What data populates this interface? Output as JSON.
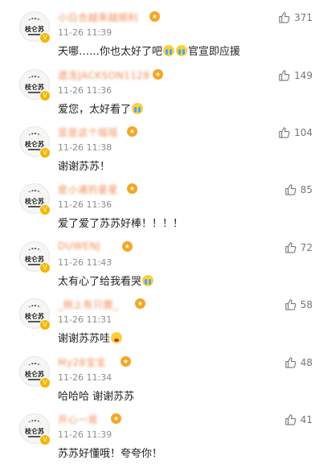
{
  "comments": [
    {
      "user": "小白合越来越顺利",
      "time": "11-26 11:39",
      "likes": "371",
      "parts": [
        {
          "t": "text",
          "v": "天哪……你也太好了吧"
        },
        {
          "t": "emoji",
          "v": "crying-face"
        },
        {
          "t": "emoji",
          "v": "crying-face"
        },
        {
          "t": "text",
          "v": "官宣即应援"
        }
      ]
    },
    {
      "user": "遗冻JACKSON1128",
      "time": "11-26 11:36",
      "likes": "149",
      "parts": [
        {
          "t": "text",
          "v": "爱您，太好看了"
        },
        {
          "t": "emoji",
          "v": "crying-face"
        }
      ]
    },
    {
      "user": "显是这个瑶瑶",
      "time": "11-26 11:38",
      "likes": "104",
      "parts": [
        {
          "t": "text",
          "v": "谢谢苏苏！"
        }
      ]
    },
    {
      "user": "是小诸的星星",
      "time": "11-26 11:36",
      "likes": "85",
      "parts": [
        {
          "t": "text",
          "v": "爱了爱了苏苏好棒！！！！"
        }
      ]
    },
    {
      "user": "DUWENJ",
      "time": "11-26 11:43",
      "likes": "72",
      "parts": [
        {
          "t": "text",
          "v": "太有心了给我看哭"
        },
        {
          "t": "emoji",
          "v": "crying-face"
        }
      ]
    },
    {
      "user": "_倒上有只鹿_",
      "time": "11-26 11:31",
      "likes": "58",
      "parts": [
        {
          "t": "text",
          "v": "谢谢苏苏哇"
        },
        {
          "t": "emoji",
          "v": "wow-face"
        }
      ]
    },
    {
      "user": "My28宝宝",
      "time": "11-26 11:34",
      "likes": "48",
      "parts": [
        {
          "t": "text",
          "v": "哈哈哈 谢谢苏苏"
        }
      ]
    },
    {
      "user": "开心一易",
      "time": "11-26 11:39",
      "likes": "41",
      "parts": [
        {
          "t": "text",
          "v": "苏苏好懂哦！夸夸你！"
        }
      ]
    }
  ],
  "avatar_text": "枝仑苏",
  "verified_mark": "V",
  "user_badge_mark": "★",
  "colors": {
    "username": "#f28a54",
    "time": "#8d8d8d",
    "text": "#222222",
    "badge": "#f5a623"
  }
}
